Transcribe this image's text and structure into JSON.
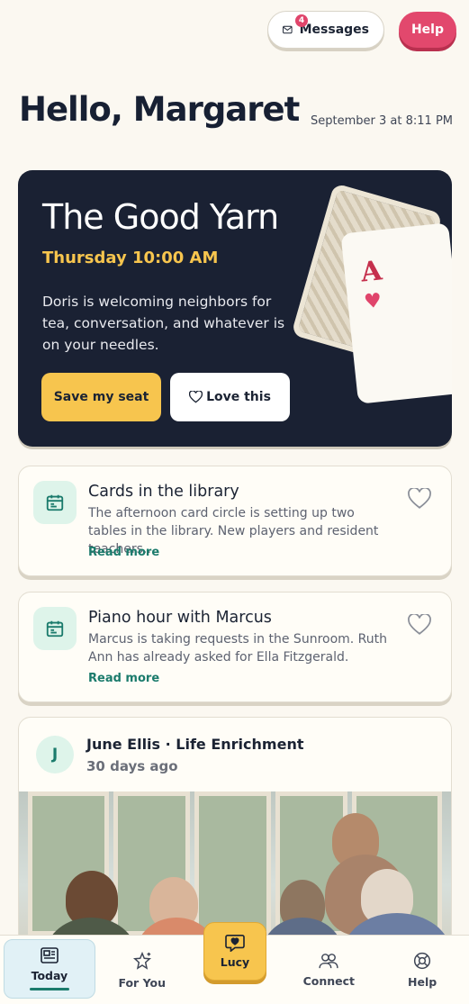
{
  "header": {
    "messages_label": "Messages",
    "messages_count": "4",
    "help_label": "Help",
    "greeting": "Hello, Margaret",
    "datetime": "September 3 at 8:11 PM"
  },
  "featured": {
    "title": "The Good Yarn",
    "time": "Thursday 10:00 AM",
    "description": "Doris is welcoming neighbors for tea, conversation, and whatever is on your needles.",
    "save_label": "Save my seat",
    "love_label": "Love this",
    "card_rank": "A",
    "card_suit": "♥"
  },
  "events": [
    {
      "title": "Cards in the library",
      "body": "The afternoon card circle is setting up two tables in the library. New players and resident teachers...",
      "more": "Read more"
    },
    {
      "title": "Piano hour with Marcus",
      "body": "Marcus is taking requests in the Sunroom. Ruth Ann has already asked for Ella Fitzgerald.",
      "more": "Read more"
    }
  ],
  "post": {
    "avatar_initial": "J",
    "author": "June Ellis · Life Enrichment",
    "ago": "30 days ago"
  },
  "nav": {
    "today": "Today",
    "for_you": "For You",
    "lucy": "Lucy",
    "connect": "Connect",
    "help": "Help"
  },
  "colors": {
    "accent_yellow": "#f7c54e",
    "accent_pink": "#e2486d",
    "accent_green": "#1b7b6c",
    "hero_bg": "#1a2133"
  }
}
